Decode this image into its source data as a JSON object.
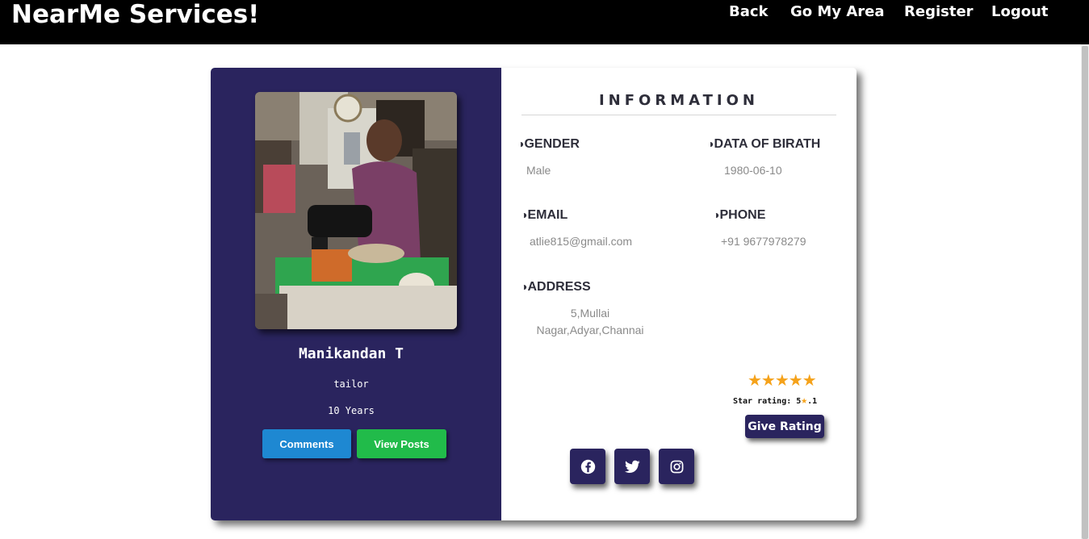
{
  "app": {
    "brand": "NearMe Services!"
  },
  "nav": {
    "items": [
      {
        "label": "Back"
      },
      {
        "label": "Go My Area"
      },
      {
        "label": "Register"
      },
      {
        "label": "Logout"
      }
    ]
  },
  "profile": {
    "name": "Manikandan T",
    "profession": "tailor",
    "experience": "10 Years",
    "buttons": {
      "comments": "Comments",
      "view_posts": "View Posts"
    }
  },
  "info": {
    "title": "INFORMATION",
    "icon_glyph": "◑",
    "gender_label": "GENDER",
    "gender_value": "Male",
    "dob_label": "DATA OF BIRATH",
    "dob_value": "1980-06-10",
    "email_label": "EMAIL",
    "email_value": "atlie815@gmail.com",
    "phone_label": "PHONE",
    "phone_value": "+91 9677978279",
    "address_label": "ADDRESS",
    "address_value": "5,Mullai Nagar,Adyar,Channai"
  },
  "rating": {
    "stars_filled": 5,
    "stars_display": "★★★★★",
    "text_prefix": "Star rating: 5",
    "text_star": "★",
    "text_suffix": ".1",
    "button": "Give Rating"
  },
  "social": {
    "icons": [
      "facebook-icon",
      "twitter-icon",
      "instagram-icon"
    ]
  },
  "colors": {
    "navbar": "#000000",
    "panel": "#2a245e",
    "comments_button": "#1e88d2",
    "posts_button": "#21bb4a",
    "star": "#f5a21a"
  }
}
